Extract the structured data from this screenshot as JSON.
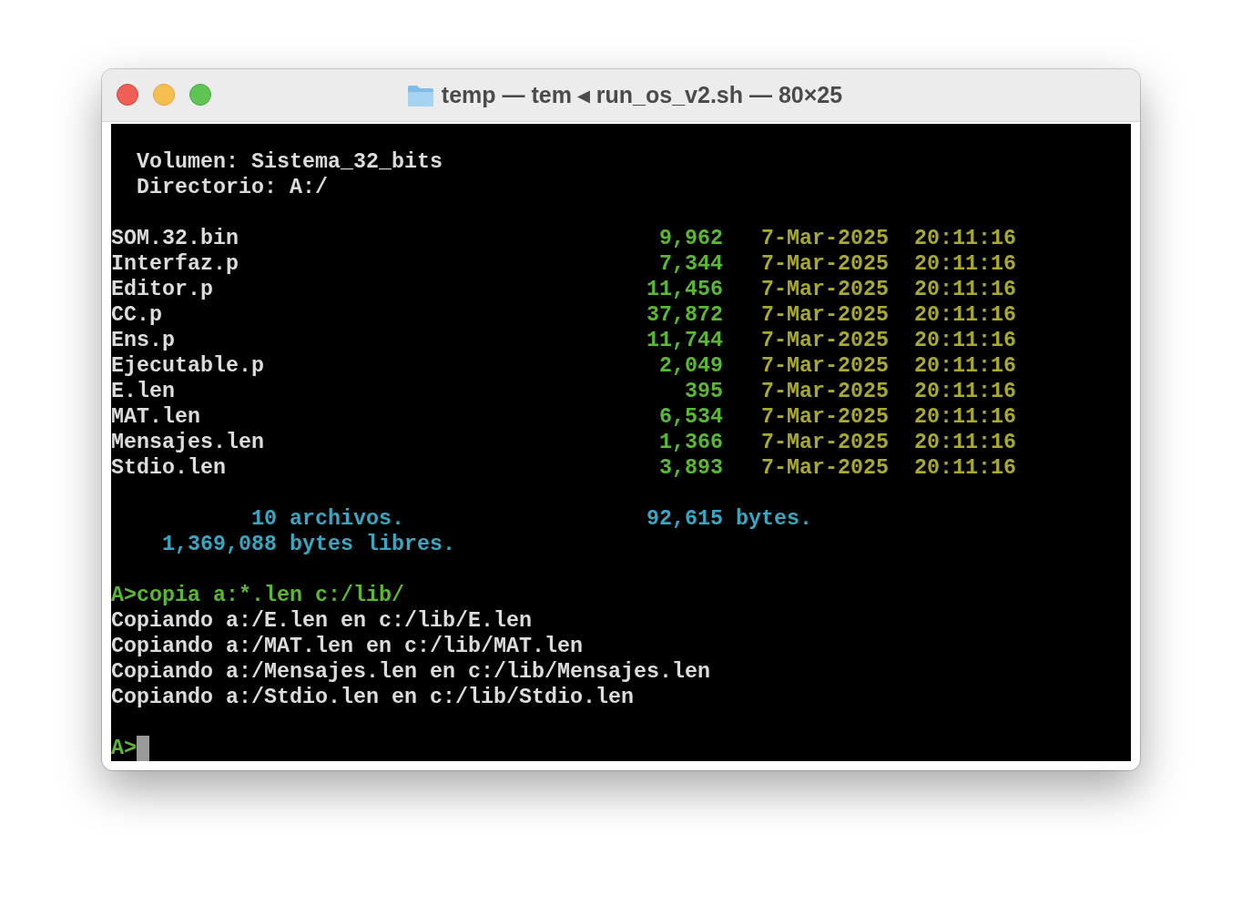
{
  "window": {
    "title": "temp — tem ◂ run_os_v2.sh — 80×25"
  },
  "terminal": {
    "header": [
      "Volumen: Sistema_32_bits",
      "Directorio: A:/"
    ],
    "files": [
      {
        "name": "SOM.32.bin",
        "size": "9,962",
        "date": "7-Mar-2025",
        "time": "20:11:16"
      },
      {
        "name": "Interfaz.p",
        "size": "7,344",
        "date": "7-Mar-2025",
        "time": "20:11:16"
      },
      {
        "name": "Editor.p",
        "size": "11,456",
        "date": "7-Mar-2025",
        "time": "20:11:16"
      },
      {
        "name": "CC.p",
        "size": "37,872",
        "date": "7-Mar-2025",
        "time": "20:11:16"
      },
      {
        "name": "Ens.p",
        "size": "11,744",
        "date": "7-Mar-2025",
        "time": "20:11:16"
      },
      {
        "name": "Ejecutable.p",
        "size": "2,049",
        "date": "7-Mar-2025",
        "time": "20:11:16"
      },
      {
        "name": "E.len",
        "size": "395",
        "date": "7-Mar-2025",
        "time": "20:11:16"
      },
      {
        "name": "MAT.len",
        "size": "6,534",
        "date": "7-Mar-2025",
        "time": "20:11:16"
      },
      {
        "name": "Mensajes.len",
        "size": "1,366",
        "date": "7-Mar-2025",
        "time": "20:11:16"
      },
      {
        "name": "Stdio.len",
        "size": "3,893",
        "date": "7-Mar-2025",
        "time": "20:11:16"
      }
    ],
    "summary": {
      "count": "10 archivos.",
      "total": "92,615 bytes.",
      "free": "1,369,088 bytes libres."
    },
    "command": "A>copia a:*.len c:/lib/",
    "output": [
      "Copiando a:/E.len en c:/lib/E.len",
      "Copiando a:/MAT.len en c:/lib/MAT.len",
      "Copiando a:/Mensajes.len en c:/lib/Mensajes.len",
      "Copiando a:/Stdio.len en c:/lib/Stdio.len"
    ],
    "prompt": "A>"
  }
}
